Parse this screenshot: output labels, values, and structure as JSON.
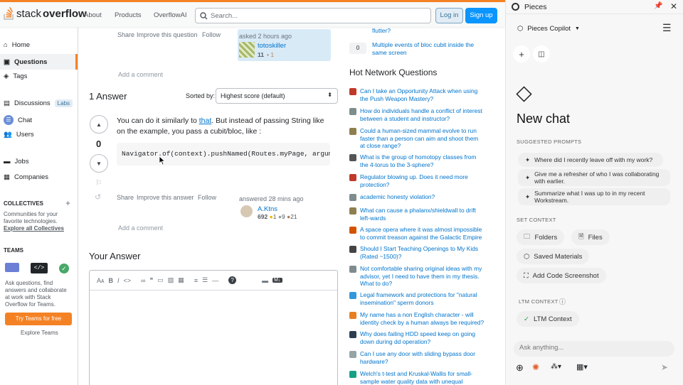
{
  "so": {
    "logo": {
      "plain": "stack",
      "bold": "overflow"
    },
    "nav": [
      "About",
      "Products",
      "OverflowAI"
    ],
    "search_placeholder": "Search...",
    "login": "Log in",
    "signup": "Sign up",
    "left": {
      "home": "Home",
      "questions": "Questions",
      "tags": "Tags",
      "discussions": "Discussions",
      "labs": "Labs",
      "chat": "Chat",
      "users": "Users",
      "jobs": "Jobs",
      "companies": "Companies",
      "collectives_title": "COLLECTIVES",
      "collectives_desc": "Communities for your favorite technologies.",
      "explore_collectives": "Explore all Collectives",
      "teams_title": "TEAMS",
      "teams_desc": "Ask questions, find answers and collaborate at work with Stack Overflow for Teams.",
      "try_teams": "Try Teams for free",
      "explore_teams": "Explore Teams"
    },
    "question": {
      "share": "Share",
      "improve": "Improve this question",
      "follow": "Follow",
      "asked": "asked 2 hours ago",
      "user": "totoskiller",
      "rep": "11",
      "bronze": "1",
      "add_comment": "Add a comment"
    },
    "answers": {
      "count": "1 Answer",
      "sorted_by": "Sorted by:",
      "sort_value": "Highest score (default)"
    },
    "answer": {
      "votes": "0",
      "text_a": "You can do it similarly to ",
      "link": "that",
      "text_b": ". But instead of passing String like on the example, you pass a cubit/bloc, like :",
      "code": "Navigator.of(context).pushNamed(Routes.myPage, arguments",
      "share": "Share",
      "improve": "Improve this answer",
      "follow": "Follow",
      "answered": "answered 28 mins ago",
      "user": "A.Ktns",
      "rep": "692",
      "gold": "1",
      "silver": "9",
      "bronze": "21",
      "add_comment": "Add a comment"
    },
    "your_answer": "Your Answer",
    "related": [
      {
        "votes": "",
        "title": "flutter?"
      },
      {
        "votes": "0",
        "title": "Multiple events of bloc cubit inside the same screen"
      }
    ],
    "hnq_title": "Hot Network Questions",
    "hnq": [
      {
        "t": "Can I take an Opportunity Attack when using the Push Weapon Mastery?",
        "c": "#c0392b"
      },
      {
        "t": "How do individuals handle a conflict of interest between a student and instructor?",
        "c": "#7f8c8d"
      },
      {
        "t": "Could a human-sized mammal evolve to run faster than a person can aim and shoot them at close range?",
        "c": "#8e7f4f"
      },
      {
        "t": "What is the group of homotopy classes from the 4-torus to the 3-sphere?",
        "c": "#555555"
      },
      {
        "t": "Regulator blowing up. Does it need more protection?",
        "c": "#c0392b"
      },
      {
        "t": "academic honesty violation?",
        "c": "#7f8c8d"
      },
      {
        "t": "What can cause a phalanx/shieldwall to drift left-wards",
        "c": "#8e7f4f"
      },
      {
        "t": "A space opera where it was almost impossible to commit treason against the Galactic Empire",
        "c": "#d35400"
      },
      {
        "t": "Should I Start Teaching Openings to My Kids (Rated ~1500)?",
        "c": "#444444"
      },
      {
        "t": "Not comfortable sharing original ideas with my advisor, yet I need to have them in my thesis. What to do?",
        "c": "#7f8c8d"
      },
      {
        "t": "Legal framework and protections for \"natural insemination\" sperm donors",
        "c": "#3498db"
      },
      {
        "t": "My name has a non English character - will identity check by a human always be required?",
        "c": "#e67e22"
      },
      {
        "t": "Why does failing HDD speed keep on going down during dd operation?",
        "c": "#2c3e50"
      },
      {
        "t": "Can I use any door with sliding bypass door hardware?",
        "c": "#95a5a6"
      },
      {
        "t": "Welch's t-test and Kruskal-Wallis for small-sample water quality data with unequal",
        "c": "#16a085"
      }
    ]
  },
  "pieces": {
    "app_title": "Pieces",
    "copilot": "Pieces Copilot",
    "heading": "New chat",
    "suggested": "SUGGESTED PROMPTS",
    "prompts": [
      "Where did I recently leave off with my work?",
      "Give me a refresher of who I was collaborating with earlier.",
      "Summarize what I was up to in my recent Workstream."
    ],
    "set_context": "SET CONTEXT",
    "folders": "Folders",
    "files": "Files",
    "saved": "Saved Materials",
    "code_shot": "Add Code Screenshot",
    "ltm_title": "LTM CONTEXT",
    "ltm": "LTM Context",
    "ask": "Ask anything..."
  }
}
